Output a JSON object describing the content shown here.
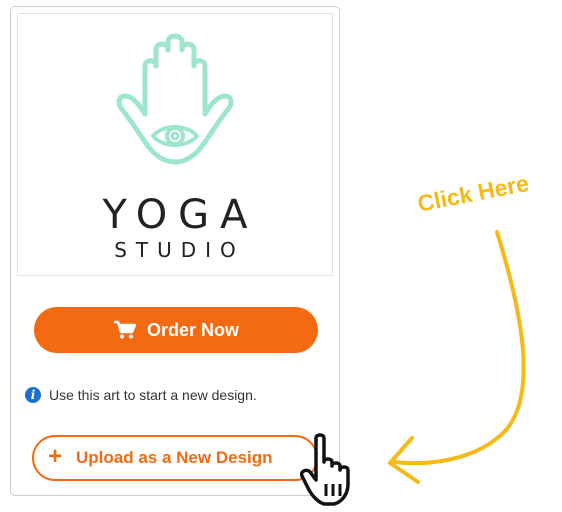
{
  "preview": {
    "logo_title": "YOGA",
    "logo_subtitle": "STUDIO",
    "logo_color": "#9ee5cd"
  },
  "actions": {
    "order_label": "Order Now",
    "order_icon": "cart-icon",
    "info_text": "Use this art to start a new design.",
    "info_icon": "info-icon",
    "upload_label": "Upload as a New Design",
    "upload_icon": "plus-icon"
  },
  "annotation": {
    "callout_text": "Click Here",
    "callout_color": "#f7b916"
  },
  "colors": {
    "accent": "#f46a11",
    "info": "#1a6fd0"
  }
}
